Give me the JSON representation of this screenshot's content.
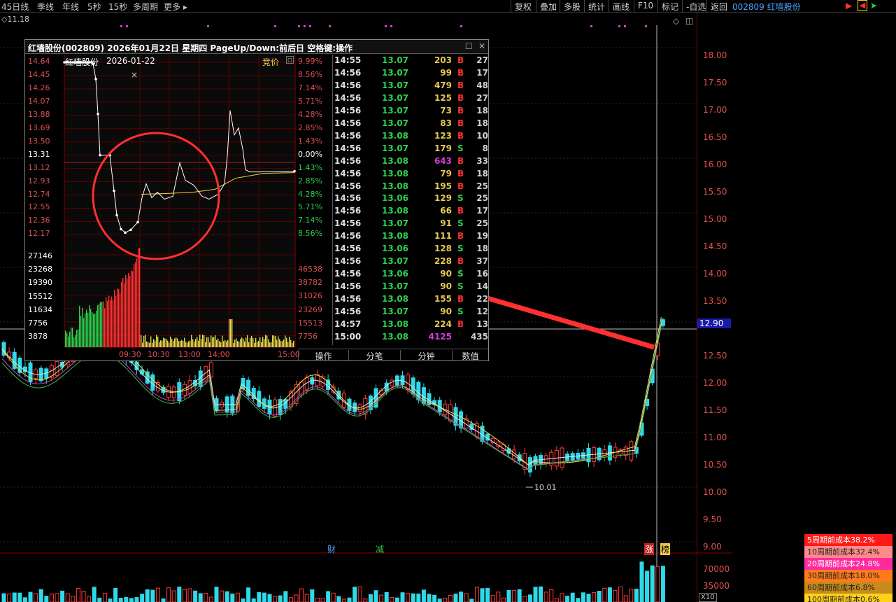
{
  "topbar": {
    "tabs": [
      "45日线",
      "季线",
      "年线",
      "5秒",
      "15秒",
      "多周期",
      "更多"
    ],
    "right_buttons": [
      "复权",
      "叠加",
      "多股",
      "统计",
      "画线",
      "F10",
      "标记",
      "-自选",
      "返回"
    ],
    "stock_title": "002809 红墙股份",
    "left_value": "11.18"
  },
  "price_axis": {
    "labels": [
      "18.00",
      "17.50",
      "17.00",
      "16.50",
      "16.00",
      "15.50",
      "15.00",
      "14.50",
      "14.00",
      "13.50",
      "12.90",
      "12.50",
      "12.00",
      "11.50",
      "11.00",
      "10.50",
      "10.00",
      "9.50",
      "9.00"
    ],
    "current_price": "12.90",
    "volume_labels": [
      "70000",
      "35000",
      "X10"
    ]
  },
  "chart_markers": {
    "low_label": "10.01",
    "events": [
      "财",
      "减",
      "涨",
      "榜"
    ]
  },
  "popup": {
    "title": "红墙股份(002809)  2026年01月22日 星期四 PageUp/Down:前后日 空格键:操作",
    "stock_name": "红墙股份",
    "date": "2026-01-22",
    "auction_label": "竞价",
    "close_icon": "×",
    "price_labels": [
      "14.64",
      "14.45",
      "14.26",
      "14.07",
      "13.88",
      "13.69",
      "13.50",
      "13.31",
      "13.12",
      "12.93",
      "12.74",
      "12.55",
      "12.36",
      "12.17"
    ],
    "pct_labels": [
      "9.99%",
      "8.56%",
      "7.14%",
      "5.71%",
      "4.28%",
      "2.85%",
      "1.43%",
      "0.00%",
      "1.43%",
      "2.85%",
      "4.28%",
      "5.71%",
      "7.14%",
      "8.56%"
    ],
    "vol_left": [
      "27146",
      "23268",
      "19390",
      "15512",
      "11634",
      "7756",
      "3878"
    ],
    "vol_right": [
      "46538",
      "38782",
      "31026",
      "23269",
      "15513",
      "7756"
    ],
    "time_labels": [
      "09:30",
      "10:30",
      "13:00",
      "14:00",
      "15:00"
    ],
    "tabs": [
      "操作",
      "分笔",
      "分钟",
      "数值"
    ]
  },
  "ticks": [
    {
      "t": "14:55",
      "p": "13.07",
      "v": "203",
      "s": "B",
      "n": "27"
    },
    {
      "t": "14:56",
      "p": "13.07",
      "v": "99",
      "s": "B",
      "n": "17"
    },
    {
      "t": "14:56",
      "p": "13.07",
      "v": "479",
      "s": "B",
      "n": "48"
    },
    {
      "t": "14:56",
      "p": "13.07",
      "v": "125",
      "s": "B",
      "n": "27"
    },
    {
      "t": "14:56",
      "p": "13.07",
      "v": "73",
      "s": "B",
      "n": "18"
    },
    {
      "t": "14:56",
      "p": "13.07",
      "v": "83",
      "s": "B",
      "n": "18"
    },
    {
      "t": "14:56",
      "p": "13.08",
      "v": "123",
      "s": "B",
      "n": "10"
    },
    {
      "t": "14:56",
      "p": "13.07",
      "v": "179",
      "s": "S",
      "n": "8"
    },
    {
      "t": "14:56",
      "p": "13.08",
      "v": "643",
      "s": "B",
      "n": "33"
    },
    {
      "t": "14:56",
      "p": "13.08",
      "v": "79",
      "s": "B",
      "n": "18"
    },
    {
      "t": "14:56",
      "p": "13.08",
      "v": "195",
      "s": "B",
      "n": "25"
    },
    {
      "t": "14:56",
      "p": "13.06",
      "v": "129",
      "s": "S",
      "n": "25"
    },
    {
      "t": "14:56",
      "p": "13.08",
      "v": "66",
      "s": "B",
      "n": "17"
    },
    {
      "t": "14:56",
      "p": "13.07",
      "v": "91",
      "s": "S",
      "n": "25"
    },
    {
      "t": "14:56",
      "p": "13.08",
      "v": "111",
      "s": "B",
      "n": "19"
    },
    {
      "t": "14:56",
      "p": "13.06",
      "v": "128",
      "s": "S",
      "n": "18"
    },
    {
      "t": "14:56",
      "p": "13.07",
      "v": "228",
      "s": "B",
      "n": "37"
    },
    {
      "t": "14:56",
      "p": "13.06",
      "v": "90",
      "s": "S",
      "n": "16"
    },
    {
      "t": "14:56",
      "p": "13.07",
      "v": "90",
      "s": "S",
      "n": "14"
    },
    {
      "t": "14:56",
      "p": "13.08",
      "v": "155",
      "s": "B",
      "n": "22"
    },
    {
      "t": "14:56",
      "p": "13.07",
      "v": "90",
      "s": "S",
      "n": "12"
    },
    {
      "t": "14:57",
      "p": "13.08",
      "v": "224",
      "s": "B",
      "n": "13"
    },
    {
      "t": "15:00",
      "p": "13.08",
      "v": "4125",
      "s": "",
      "n": "435"
    }
  ],
  "cost_legend": [
    {
      "label": "5周期前成本38.2%",
      "color": "#ff1a1a",
      "text": "#fff"
    },
    {
      "label": "10周期前成本32.4%",
      "color": "#ff8a8a",
      "text": "#222"
    },
    {
      "label": "20周期前成本24.8%",
      "color": "#ff2aa0",
      "text": "#fff"
    },
    {
      "label": "30周期前成本18.0%",
      "color": "#ff7a1a",
      "text": "#222"
    },
    {
      "label": "60周期前成本6.8%",
      "color": "#c88a1a",
      "text": "#222"
    },
    {
      "label": "100周期前成本0.6%",
      "color": "#ffd21a",
      "text": "#222"
    }
  ],
  "colors": {
    "up": "#ff3a3a",
    "down": "#2fd9e8",
    "ma_white": "#e6e6e6",
    "ma_yellow": "#f0e040",
    "ma_magenta": "#d040d0",
    "ma_green": "#30c030",
    "annotation": "#ff3030"
  }
}
